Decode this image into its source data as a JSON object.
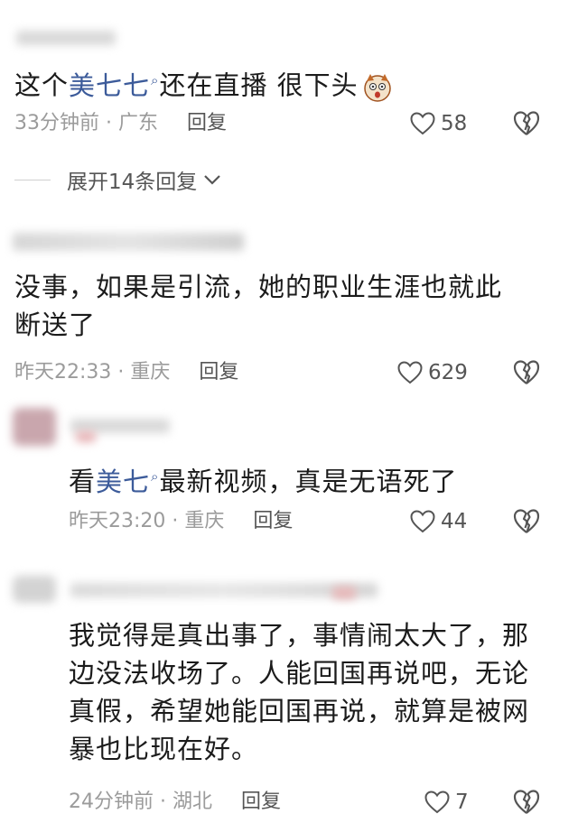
{
  "comments": [
    {
      "text_prefix": "这个",
      "link": "美七七",
      "text_suffix": "还在直播  很下头",
      "time": "33分钟前 · 广东",
      "reply": "回复",
      "likes": "58",
      "expand": "展开14条回复"
    },
    {
      "line1": "没事，如果是引流，她的职业生涯也就此",
      "line2": "断送了",
      "time": "昨天22:33 · 重庆",
      "reply": "回复",
      "likes": "629"
    },
    {
      "text_prefix": "看",
      "link": "美七",
      "text_suffix": "最新视频，真是无语死了",
      "time": "昨天23:20 · 重庆",
      "reply": "回复",
      "likes": "44"
    },
    {
      "line1": "我觉得是真出事了，事情闹太大了，那",
      "line2": "边没法收场了。人能回国再说吧，无论",
      "line3": "真假，希望她能回国再说，就算是被网",
      "line4": "暴也比现在好。",
      "time": "24分钟前 · 湖北",
      "reply": "回复",
      "likes": "7"
    }
  ],
  "icons": {
    "search": "search-icon",
    "like": "heart-outline-icon",
    "dislike": "broken-heart-icon",
    "chevron": "chevron-down-icon",
    "emoji": "surprised-dog-emoji"
  }
}
